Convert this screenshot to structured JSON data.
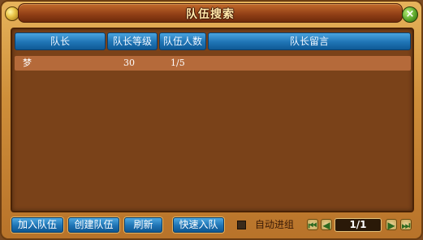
{
  "window": {
    "title": "队伍搜索",
    "close_glyph": "×"
  },
  "table": {
    "columns": [
      "队长",
      "队长等级",
      "队伍人数",
      "队长留言"
    ],
    "rows": [
      {
        "leader": "梦",
        "level": "30",
        "members": "1/5",
        "message": ""
      }
    ]
  },
  "toolbar": {
    "join_label": "加入队伍",
    "create_label": "创建队伍",
    "refresh_label": "刷新",
    "quick_join_label": "快速入队",
    "auto_group_label": "自动进组",
    "auto_group_checked": false
  },
  "pager": {
    "page_text": "1/1",
    "first_glyph": "⏮",
    "prev_glyph": "◀",
    "next_glyph": "▶",
    "last_glyph": "⏭"
  },
  "icons": {
    "left_ornament": "gold-orb-icon",
    "close": "close-icon"
  },
  "colors": {
    "header_blue": "#1f74b5",
    "panel_brown": "#7a4219",
    "row_highlight": "#b56a3a",
    "frame_gold": "#cf8f3a"
  }
}
